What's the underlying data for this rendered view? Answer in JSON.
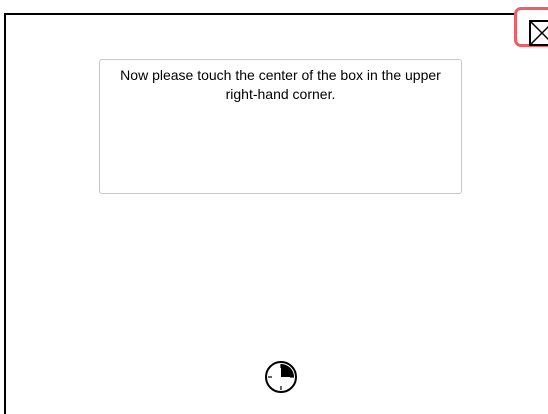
{
  "window": {
    "title": ""
  },
  "instruction": {
    "text": "Now please touch the center of the box in the upper right-hand corner."
  },
  "target": {
    "icon": "calibration-target-icon",
    "highlight_color": "#f25c63"
  },
  "timer": {
    "icon": "countdown-timer-icon",
    "progress": 0.25
  }
}
